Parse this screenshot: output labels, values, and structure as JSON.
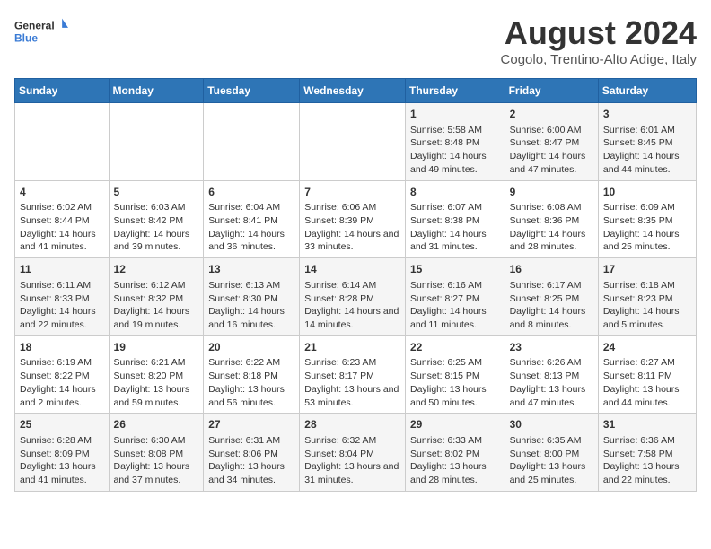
{
  "header": {
    "logo_general": "General",
    "logo_blue": "Blue",
    "title": "August 2024",
    "subtitle": "Cogolo, Trentino-Alto Adige, Italy"
  },
  "weekdays": [
    "Sunday",
    "Monday",
    "Tuesday",
    "Wednesday",
    "Thursday",
    "Friday",
    "Saturday"
  ],
  "weeks": [
    [
      {
        "day": "",
        "text": ""
      },
      {
        "day": "",
        "text": ""
      },
      {
        "day": "",
        "text": ""
      },
      {
        "day": "",
        "text": ""
      },
      {
        "day": "1",
        "text": "Sunrise: 5:58 AM\nSunset: 8:48 PM\nDaylight: 14 hours and 49 minutes."
      },
      {
        "day": "2",
        "text": "Sunrise: 6:00 AM\nSunset: 8:47 PM\nDaylight: 14 hours and 47 minutes."
      },
      {
        "day": "3",
        "text": "Sunrise: 6:01 AM\nSunset: 8:45 PM\nDaylight: 14 hours and 44 minutes."
      }
    ],
    [
      {
        "day": "4",
        "text": "Sunrise: 6:02 AM\nSunset: 8:44 PM\nDaylight: 14 hours and 41 minutes."
      },
      {
        "day": "5",
        "text": "Sunrise: 6:03 AM\nSunset: 8:42 PM\nDaylight: 14 hours and 39 minutes."
      },
      {
        "day": "6",
        "text": "Sunrise: 6:04 AM\nSunset: 8:41 PM\nDaylight: 14 hours and 36 minutes."
      },
      {
        "day": "7",
        "text": "Sunrise: 6:06 AM\nSunset: 8:39 PM\nDaylight: 14 hours and 33 minutes."
      },
      {
        "day": "8",
        "text": "Sunrise: 6:07 AM\nSunset: 8:38 PM\nDaylight: 14 hours and 31 minutes."
      },
      {
        "day": "9",
        "text": "Sunrise: 6:08 AM\nSunset: 8:36 PM\nDaylight: 14 hours and 28 minutes."
      },
      {
        "day": "10",
        "text": "Sunrise: 6:09 AM\nSunset: 8:35 PM\nDaylight: 14 hours and 25 minutes."
      }
    ],
    [
      {
        "day": "11",
        "text": "Sunrise: 6:11 AM\nSunset: 8:33 PM\nDaylight: 14 hours and 22 minutes."
      },
      {
        "day": "12",
        "text": "Sunrise: 6:12 AM\nSunset: 8:32 PM\nDaylight: 14 hours and 19 minutes."
      },
      {
        "day": "13",
        "text": "Sunrise: 6:13 AM\nSunset: 8:30 PM\nDaylight: 14 hours and 16 minutes."
      },
      {
        "day": "14",
        "text": "Sunrise: 6:14 AM\nSunset: 8:28 PM\nDaylight: 14 hours and 14 minutes."
      },
      {
        "day": "15",
        "text": "Sunrise: 6:16 AM\nSunset: 8:27 PM\nDaylight: 14 hours and 11 minutes."
      },
      {
        "day": "16",
        "text": "Sunrise: 6:17 AM\nSunset: 8:25 PM\nDaylight: 14 hours and 8 minutes."
      },
      {
        "day": "17",
        "text": "Sunrise: 6:18 AM\nSunset: 8:23 PM\nDaylight: 14 hours and 5 minutes."
      }
    ],
    [
      {
        "day": "18",
        "text": "Sunrise: 6:19 AM\nSunset: 8:22 PM\nDaylight: 14 hours and 2 minutes."
      },
      {
        "day": "19",
        "text": "Sunrise: 6:21 AM\nSunset: 8:20 PM\nDaylight: 13 hours and 59 minutes."
      },
      {
        "day": "20",
        "text": "Sunrise: 6:22 AM\nSunset: 8:18 PM\nDaylight: 13 hours and 56 minutes."
      },
      {
        "day": "21",
        "text": "Sunrise: 6:23 AM\nSunset: 8:17 PM\nDaylight: 13 hours and 53 minutes."
      },
      {
        "day": "22",
        "text": "Sunrise: 6:25 AM\nSunset: 8:15 PM\nDaylight: 13 hours and 50 minutes."
      },
      {
        "day": "23",
        "text": "Sunrise: 6:26 AM\nSunset: 8:13 PM\nDaylight: 13 hours and 47 minutes."
      },
      {
        "day": "24",
        "text": "Sunrise: 6:27 AM\nSunset: 8:11 PM\nDaylight: 13 hours and 44 minutes."
      }
    ],
    [
      {
        "day": "25",
        "text": "Sunrise: 6:28 AM\nSunset: 8:09 PM\nDaylight: 13 hours and 41 minutes."
      },
      {
        "day": "26",
        "text": "Sunrise: 6:30 AM\nSunset: 8:08 PM\nDaylight: 13 hours and 37 minutes."
      },
      {
        "day": "27",
        "text": "Sunrise: 6:31 AM\nSunset: 8:06 PM\nDaylight: 13 hours and 34 minutes."
      },
      {
        "day": "28",
        "text": "Sunrise: 6:32 AM\nSunset: 8:04 PM\nDaylight: 13 hours and 31 minutes."
      },
      {
        "day": "29",
        "text": "Sunrise: 6:33 AM\nSunset: 8:02 PM\nDaylight: 13 hours and 28 minutes."
      },
      {
        "day": "30",
        "text": "Sunrise: 6:35 AM\nSunset: 8:00 PM\nDaylight: 13 hours and 25 minutes."
      },
      {
        "day": "31",
        "text": "Sunrise: 6:36 AM\nSunset: 7:58 PM\nDaylight: 13 hours and 22 minutes."
      }
    ]
  ]
}
